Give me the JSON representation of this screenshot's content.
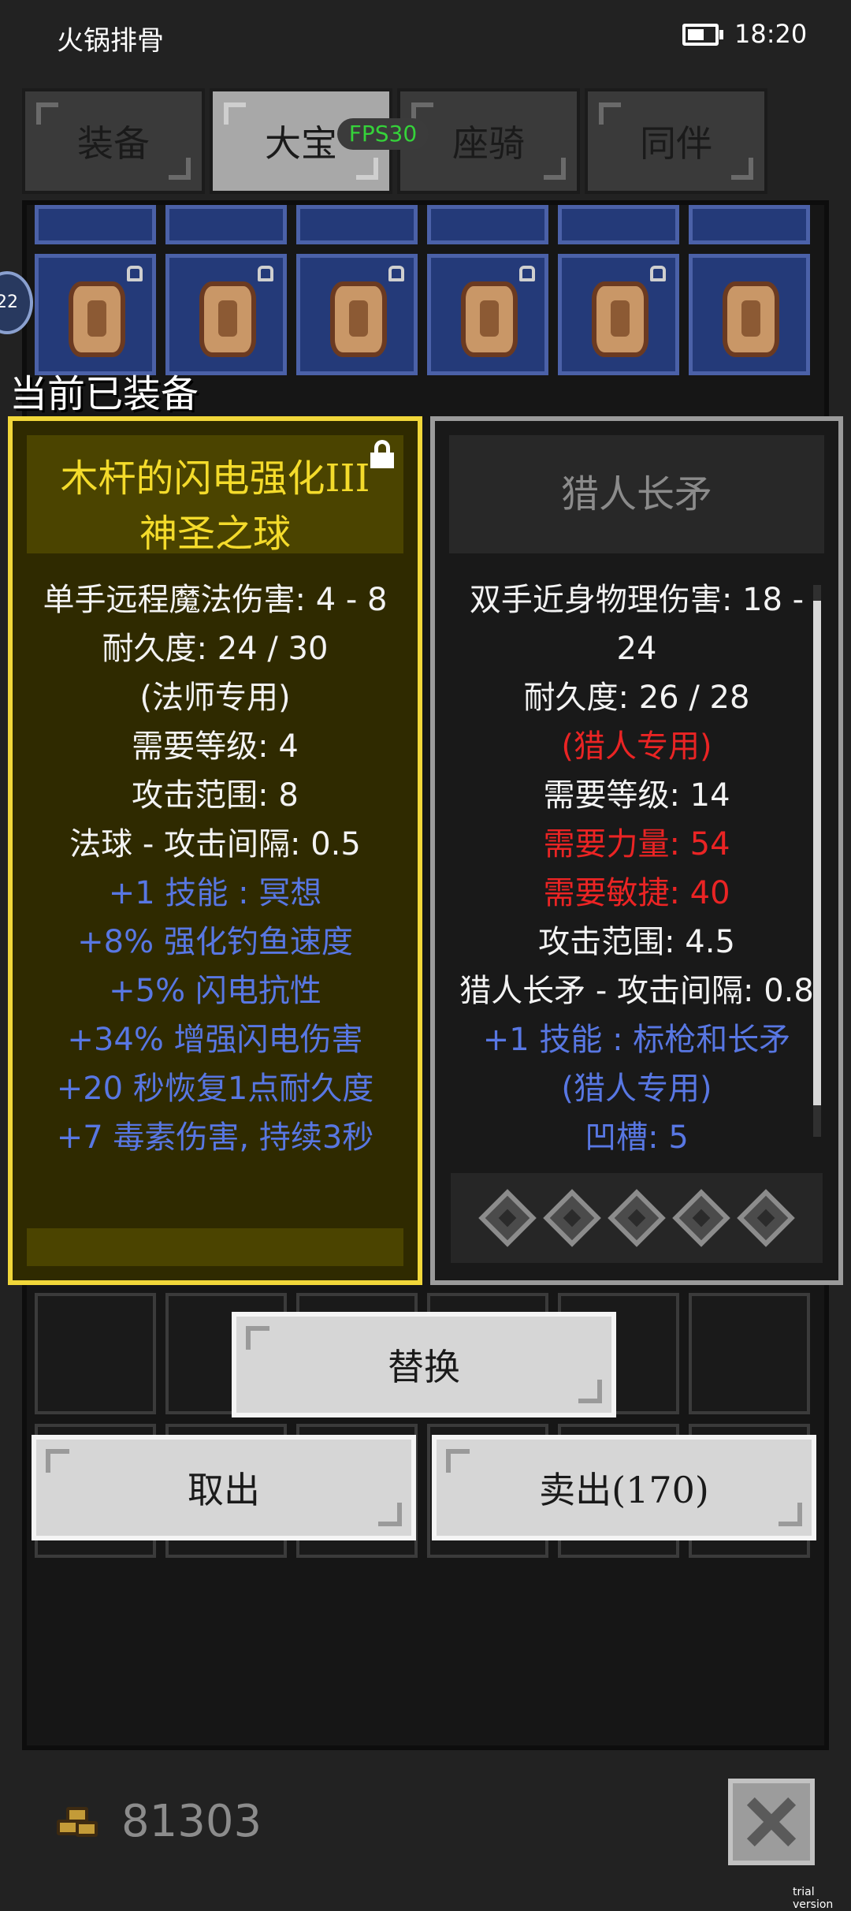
{
  "status_bar": {
    "title": "火锅排骨",
    "time": "18:20"
  },
  "tabs": [
    {
      "label": "装备",
      "active": false
    },
    {
      "label": "大宝",
      "active": true
    },
    {
      "label": "座骑",
      "active": false
    },
    {
      "label": "同伴",
      "active": false
    }
  ],
  "fps_badge": "FPS30",
  "side_bubble": "22",
  "section_label": "当前已装备",
  "equipped_item": {
    "title_line1": "木杆的闪电强化III",
    "title_line2": "神圣之球",
    "stats": [
      {
        "text": "单手远程魔法伤害: 4 - 8",
        "color": "#f3f3f3"
      },
      {
        "text": "耐久度: 24 / 30",
        "color": "#f3f3f3"
      },
      {
        "text": "(法师专用)",
        "color": "#f3f3f3"
      },
      {
        "text": "需要等级: 4",
        "color": "#f3f3f3"
      },
      {
        "text": "攻击范围: 8",
        "color": "#f3f3f3"
      },
      {
        "text": "法球 - 攻击间隔: 0.5",
        "color": "#f3f3f3"
      },
      {
        "text": "+1 技能 : 冥想",
        "color": "#5877e3"
      },
      {
        "text": "+8% 强化钓鱼速度",
        "color": "#5877e3"
      },
      {
        "text": "+5% 闪电抗性",
        "color": "#5877e3"
      },
      {
        "text": "+34% 增强闪电伤害",
        "color": "#5877e3"
      },
      {
        "text": "+20 秒恢复1点耐久度",
        "color": "#5877e3"
      },
      {
        "text": "+7 毒素伤害, 持续3秒",
        "color": "#5877e3"
      }
    ]
  },
  "compare_item": {
    "title": "猎人长矛",
    "stats": [
      {
        "text": "双手近身物理伤害: 18 -",
        "color": "#f3f3f3"
      },
      {
        "text": "24",
        "color": "#f3f3f3"
      },
      {
        "text": "耐久度: 26 / 28",
        "color": "#f3f3f3"
      },
      {
        "text": "(猎人专用)",
        "color": "#ea2424"
      },
      {
        "text": "需要等级: 14",
        "color": "#f3f3f3"
      },
      {
        "text": "需要力量: 54",
        "color": "#ea2424"
      },
      {
        "text": "需要敏捷: 40",
        "color": "#ea2424"
      },
      {
        "text": "攻击范围: 4.5",
        "color": "#f3f3f3"
      },
      {
        "text": "猎人长矛 - 攻击间隔: 0.8",
        "color": "#f3f3f3"
      },
      {
        "text": "+1 技能 : 标枪和长矛",
        "color": "#5877e3"
      },
      {
        "text": "(猎人专用)",
        "color": "#5877e3"
      },
      {
        "text": "凹槽: 5",
        "color": "#5877e3"
      }
    ],
    "socket_count": 5
  },
  "buttons": {
    "replace": "替换",
    "take_out": "取出",
    "sell": "卖出(170)"
  },
  "gold_amount": "81303",
  "watermark": "trial version"
}
